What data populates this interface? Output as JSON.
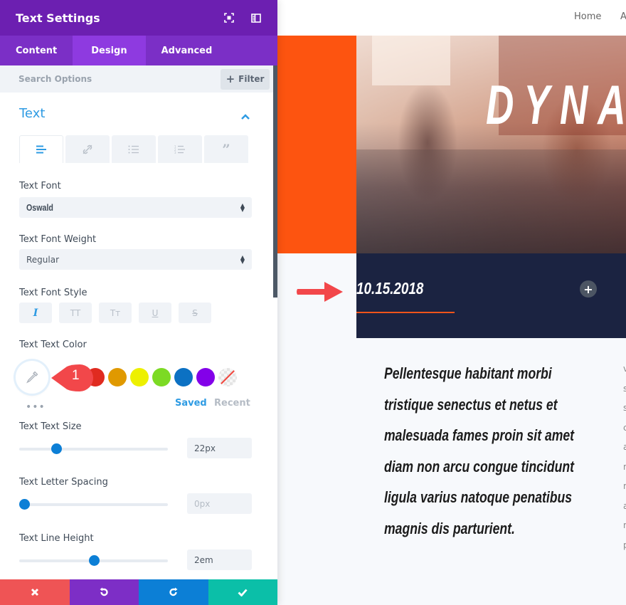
{
  "panel": {
    "title": "Text Settings",
    "header_icons": [
      "fullscreen-icon",
      "sidebar-toggle-icon"
    ],
    "tabs": [
      {
        "label": "Content",
        "active": false
      },
      {
        "label": "Design",
        "active": true
      },
      {
        "label": "Advanced",
        "active": false
      }
    ],
    "search": {
      "placeholder": "Search Options",
      "value": ""
    },
    "filter_label": "Filter",
    "section": {
      "title": "Text",
      "expanded": true,
      "text_tabs": [
        "align-left-icon",
        "link-icon",
        "bullet-list-icon",
        "numbered-list-icon",
        "quote-icon"
      ],
      "active_text_tab": 0
    },
    "fields": {
      "text_font": {
        "label": "Text Font",
        "value": "Oswald"
      },
      "text_font_weight": {
        "label": "Text Font Weight",
        "value": "Regular"
      },
      "text_font_style": {
        "label": "Text Font Style",
        "options": [
          {
            "icon": "italic-icon",
            "glyph": "I",
            "active": true
          },
          {
            "icon": "uppercase-icon",
            "glyph": "TT",
            "active": false
          },
          {
            "icon": "smallcaps-icon",
            "glyph": "Tт",
            "active": false
          },
          {
            "icon": "underline-icon",
            "glyph": "U",
            "active": false
          },
          {
            "icon": "strikethrough-icon",
            "glyph": "S",
            "active": false
          }
        ]
      },
      "text_color": {
        "label": "Text Text Color",
        "swatches": [
          "#ffffff",
          "#e02b20",
          "#e09900",
          "#edf000",
          "#7cda24",
          "#0c71c3",
          "#8300e9",
          "none"
        ],
        "palette_tabs": {
          "saved": "Saved",
          "recent": "Recent"
        },
        "active_palette_tab": "saved",
        "more": "•••"
      },
      "text_size": {
        "label": "Text Text Size",
        "value": "22px",
        "slider_fraction": 0.23
      },
      "letter_spacing": {
        "label": "Text Letter Spacing",
        "value": "0px",
        "slider_fraction": 0.0
      },
      "line_height": {
        "label": "Text Line Height",
        "value": "2em",
        "slider_fraction": 0.5
      }
    },
    "callout": {
      "number": "1",
      "color": "#f2474a"
    },
    "footer": {
      "cancel": "close-icon",
      "undo": "undo-icon",
      "redo": "redo-icon",
      "save": "check-icon"
    }
  },
  "preview": {
    "nav": [
      "Home",
      "A"
    ],
    "hero_title": "DYNA",
    "date": "10.15.2018",
    "quote_lines": [
      "Pellentesque habitant morbi",
      "tristique senectus et netus et",
      "malesuada fames proin sit amet",
      "diam non arcu congue tincidunt",
      "ligula varius natoque penatibus",
      "magnis dis parturient."
    ],
    "side_column_letters": [
      "v",
      "s",
      "s",
      "c",
      "a",
      "n",
      "n",
      "a",
      "n",
      "p"
    ]
  },
  "colors": {
    "header_purple": "#6c1fb1",
    "tab_purple": "#7b2fc6",
    "accent_blue": "#2e9be3",
    "orange": "#fd5410",
    "navy": "#1b2341"
  }
}
